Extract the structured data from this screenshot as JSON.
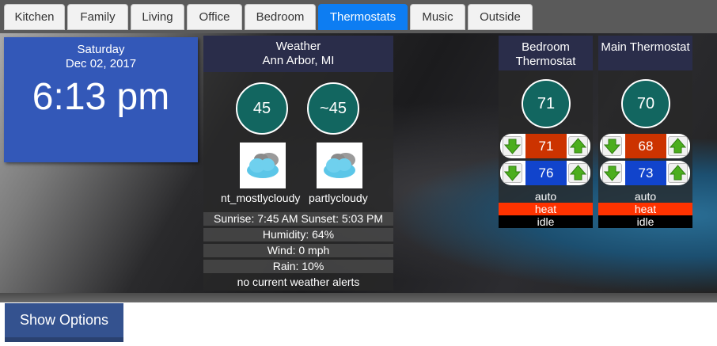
{
  "tabs": [
    {
      "label": "Kitchen",
      "active": false
    },
    {
      "label": "Family",
      "active": false
    },
    {
      "label": "Living",
      "active": false
    },
    {
      "label": "Office",
      "active": false
    },
    {
      "label": "Bedroom",
      "active": false
    },
    {
      "label": "Thermostats",
      "active": true
    },
    {
      "label": "Music",
      "active": false
    },
    {
      "label": "Outside",
      "active": false
    }
  ],
  "clock": {
    "day": "Saturday",
    "date": "Dec 02, 2017",
    "time": "6:13 pm"
  },
  "weather": {
    "title": "Weather",
    "location": "Ann Arbor, MI",
    "current_temp": "45",
    "forecast_temp": "~45",
    "current_icon": "partly-cloudy-icon",
    "current_condition": "nt_mostlycloudy",
    "forecast_icon": "partly-cloudy-icon",
    "forecast_condition": "partlycloudy",
    "sun": "Sunrise: 7:45 AM Sunset: 5:03 PM",
    "humidity": "Humidity: 64%",
    "wind": "Wind: 0 mph",
    "rain": "Rain: 10%",
    "alerts": "no current weather alerts"
  },
  "thermostats": [
    {
      "title": "Bedroom Thermostat",
      "current": "71",
      "heat_setpoint": "71",
      "cool_setpoint": "76",
      "mode": "auto",
      "operating_state": "heat",
      "fan": "idle"
    },
    {
      "title": "Main Thermostat",
      "current": "70",
      "heat_setpoint": "68",
      "cool_setpoint": "73",
      "mode": "auto",
      "operating_state": "heat",
      "fan": "idle"
    }
  ],
  "options_button": "Show Options",
  "colors": {
    "active_tab": "#0d7df2",
    "clock_bg": "#3358b8",
    "temp_circle": "#126660",
    "heat_setpoint": "#cc3300",
    "cool_setpoint": "#1144cc",
    "heat_state": "#ff3300",
    "arrow_green": "#4cae1e"
  }
}
